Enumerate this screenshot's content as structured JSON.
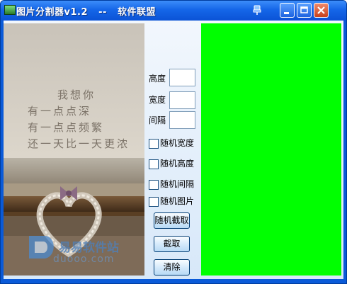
{
  "window": {
    "title": "图片分割器v1.2   --   软件联盟"
  },
  "image": {
    "poem_lines": [
      "我想你",
      "有一点点深",
      "有一点点频繁",
      "还一天比一天更浓"
    ],
    "watermark_text": "易易软件站",
    "watermark_url": "duooo.com"
  },
  "controls": {
    "height_label": "高度",
    "width_label": "宽度",
    "interval_label": "间隔",
    "height_value": "",
    "width_value": "",
    "interval_value": "",
    "random_width_label": "随机宽度",
    "random_height_label": "随机高度",
    "random_interval_label": "随机间隔",
    "random_picture_label": "随机图片",
    "random_cut_button": "随机截取",
    "cut_button": "截取",
    "clear_button": "清除"
  },
  "preview": {
    "color": "#00ff00"
  }
}
